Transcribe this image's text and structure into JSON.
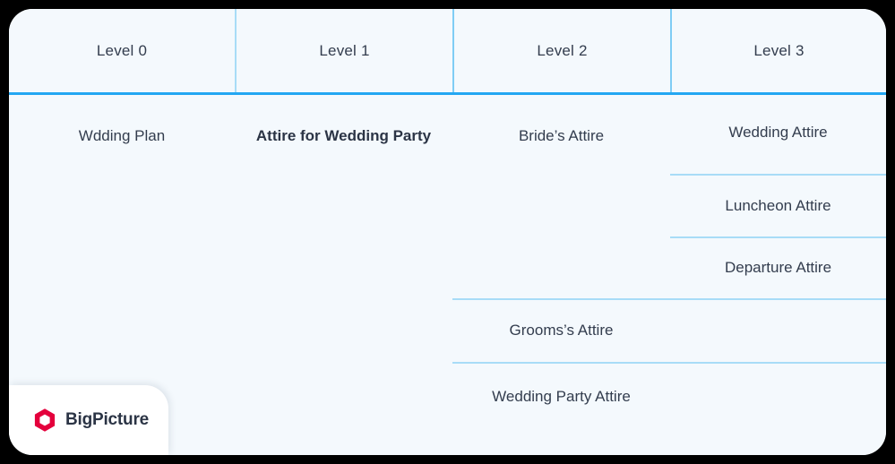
{
  "card": {
    "background_color": "#F4F9FD",
    "border_color": "#A8DCF7",
    "header_rule_color": "#23A7F2",
    "text_color": "#333D4E"
  },
  "table": {
    "headers": [
      {
        "label": "Level 0"
      },
      {
        "label": "Level 1"
      },
      {
        "label": "Level 2"
      },
      {
        "label": "Level 3"
      }
    ],
    "columns": {
      "level0": {
        "header": "Level 0",
        "cells": [
          {
            "text": "Wdding Plan",
            "bold": false
          }
        ]
      },
      "level1": {
        "header": "Level 1",
        "cells": [
          {
            "text": "Attire for Wedding Party",
            "bold": true
          }
        ]
      },
      "level2": {
        "header": "Level 2",
        "cells": [
          {
            "text": "Bride’s Attire",
            "bold": false
          },
          {
            "text": "Grooms’s Attire",
            "bold": false
          },
          {
            "text": "Wedding Party Attire",
            "bold": false
          }
        ]
      },
      "level3": {
        "header": "Level 3",
        "cells": [
          {
            "text": "Wedding Attire",
            "bold": false
          },
          {
            "text": "Luncheon Attire",
            "bold": false
          },
          {
            "text": "Departure Attire",
            "bold": false
          },
          {
            "text": "",
            "bold": false
          },
          {
            "text": "",
            "bold": false
          }
        ]
      }
    }
  },
  "badge": {
    "brand_name": "BigPicture",
    "logo_icon": "hexagon-logo-icon",
    "logo_color": "#E4003C",
    "logo_inner_color": "#FFFFFF",
    "background_color": "#FFFFFF"
  }
}
